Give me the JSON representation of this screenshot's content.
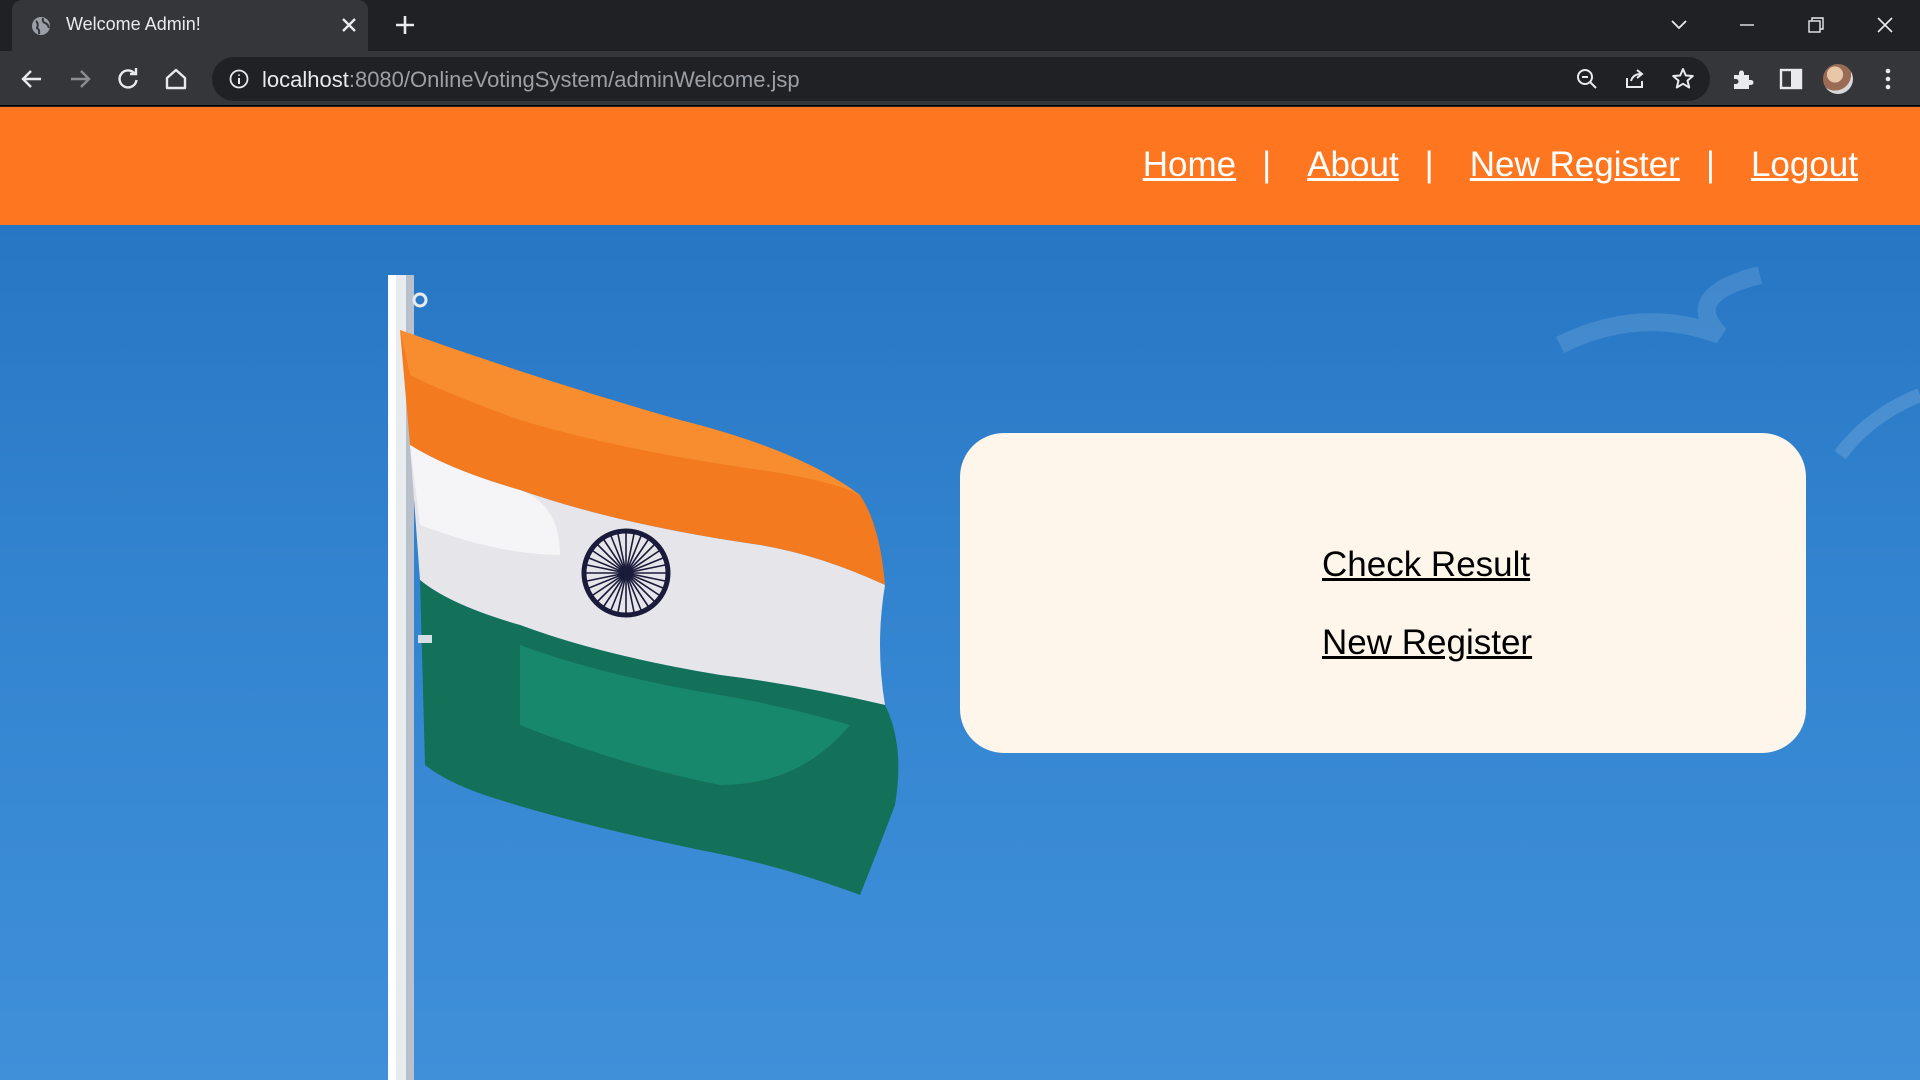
{
  "browser": {
    "tab_title": "Welcome Admin!",
    "url_host": "localhost",
    "url_rest": ":8080/OnlineVotingSystem/adminWelcome.jsp",
    "icons": [
      "globe-icon",
      "close-icon",
      "plus-icon",
      "chevron-down-icon",
      "minimize-icon",
      "restore-icon",
      "close-window-icon",
      "back-icon",
      "forward-icon",
      "reload-icon",
      "home-icon",
      "info-icon",
      "zoom-icon",
      "share-icon",
      "star-icon",
      "extensions-icon",
      "side-panel-icon",
      "kebab-menu-icon"
    ]
  },
  "nav": {
    "home": "Home",
    "about": "About",
    "new_register": "New Register",
    "logout": "Logout",
    "separator": "|"
  },
  "card": {
    "check_result": "Check Result",
    "new_register": "New Register"
  },
  "colors": {
    "navbar": "#fe761f",
    "sky": "#3283cf",
    "card": "#fef6ea",
    "flag_saffron": "#f47a1f",
    "flag_white": "#e6e6ea",
    "flag_green": "#13715a",
    "chakra": "#1a1a3a"
  }
}
